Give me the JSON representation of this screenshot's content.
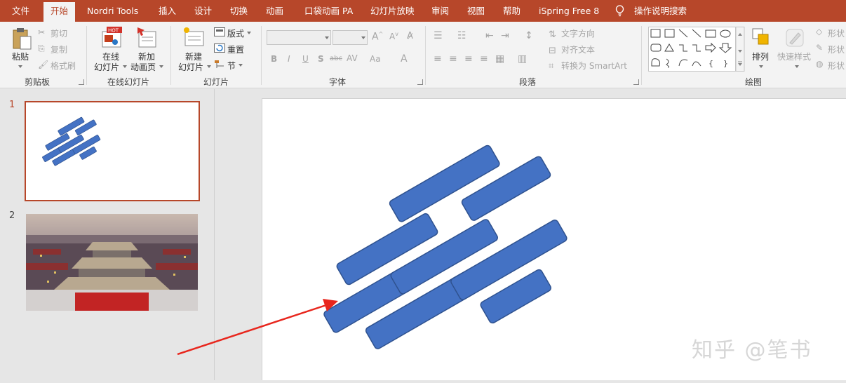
{
  "menubar": {
    "tabs": [
      {
        "label": "文件"
      },
      {
        "label": "开始"
      },
      {
        "label": "Nordri Tools"
      },
      {
        "label": "插入"
      },
      {
        "label": "设计"
      },
      {
        "label": "切换"
      },
      {
        "label": "动画"
      },
      {
        "label": "口袋动画 PA"
      },
      {
        "label": "幻灯片放映"
      },
      {
        "label": "审阅"
      },
      {
        "label": "视图"
      },
      {
        "label": "帮助"
      },
      {
        "label": "iSpring Free 8"
      }
    ],
    "search": "操作说明搜索"
  },
  "ribbon": {
    "clipboard": {
      "paste": "粘贴",
      "cut": "剪切",
      "copy": "复制",
      "format_painter": "格式刷",
      "group": "剪贴板"
    },
    "online_slides": {
      "online": "在线",
      "online2": "幻灯片",
      "new_anim": "新加",
      "new_anim2": "动画页",
      "badge": "HOT",
      "group": "在线幻灯片"
    },
    "slides": {
      "new": "新建",
      "new2": "幻灯片",
      "layout": "版式",
      "reset": "重置",
      "section": "节",
      "group": "幻灯片"
    },
    "font": {
      "group": "字体",
      "bold": "B",
      "italic": "I",
      "underline": "U",
      "shadow": "S",
      "strike": "abc",
      "spacing": "AV",
      "case": "Aa",
      "color": "A"
    },
    "paragraph": {
      "group": "段落",
      "text_direction": "文字方向",
      "align_text": "对齐文本",
      "smartart": "转换为 SmartArt"
    },
    "drawing": {
      "group": "绘图",
      "arrange": "排列",
      "quick_styles": "快速样式",
      "shape_fill": "形状",
      "shape_outline": "形状",
      "shape_effects": "形状"
    }
  },
  "slides_pane": {
    "slides": [
      {
        "number": "1"
      },
      {
        "number": "2"
      }
    ]
  },
  "watermark": "知乎 @笔书",
  "colors": {
    "accent": "#b7472a",
    "shape_fill": "#4472c4",
    "shape_stroke": "#2f528f",
    "arrow": "#e8261d"
  }
}
